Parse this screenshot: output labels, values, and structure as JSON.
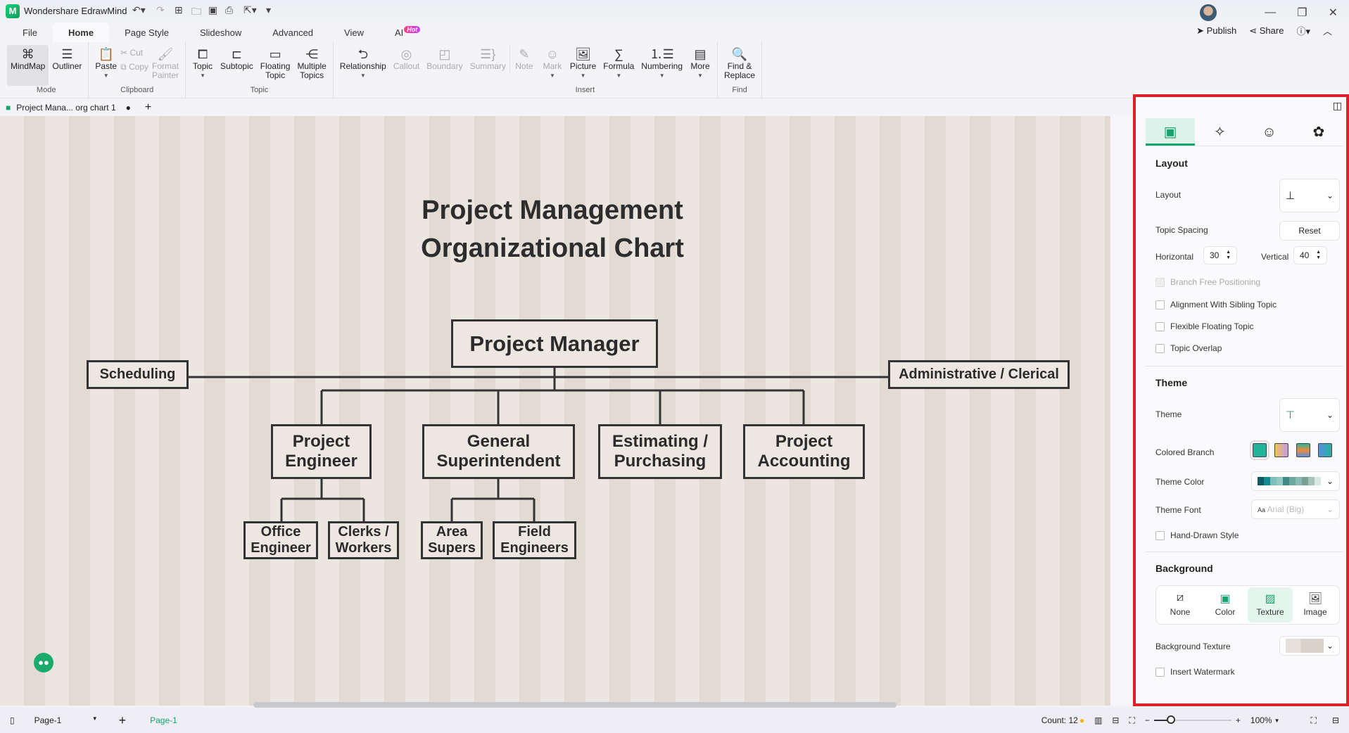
{
  "app": {
    "name": "Wondershare EdrawMind",
    "logo": "M"
  },
  "menu_tabs": [
    {
      "label": "File"
    },
    {
      "label": "Home",
      "active": true
    },
    {
      "label": "Page Style"
    },
    {
      "label": "Slideshow"
    },
    {
      "label": "Advanced"
    },
    {
      "label": "View"
    },
    {
      "label": "AI",
      "badge": "Hot"
    }
  ],
  "top_actions": {
    "publish": "Publish",
    "share": "Share"
  },
  "ribbon": {
    "mode": {
      "label": "Mode",
      "items": [
        "MindMap",
        "Outliner"
      ]
    },
    "clipboard": {
      "label": "Clipboard",
      "paste": "Paste",
      "cut": "Cut",
      "copy": "Copy",
      "format_painter": [
        "Format",
        "Painter"
      ]
    },
    "topic": {
      "label": "Topic",
      "items": [
        [
          "Topic",
          ""
        ],
        [
          "Subtopic",
          ""
        ],
        [
          "Floating",
          "Topic"
        ],
        [
          "Multiple",
          "Topics"
        ]
      ]
    },
    "insert": {
      "label": "Insert",
      "items": [
        "Relationship",
        "Callout",
        "Boundary",
        "Summary",
        "Note",
        "Mark",
        "Picture",
        "Formula",
        "Numbering",
        "More"
      ]
    },
    "find": {
      "label": "Find",
      "items": [
        "Find &",
        "Replace"
      ]
    }
  },
  "document_tab": {
    "title": "Project Mana... org chart 1"
  },
  "chart": {
    "title": [
      "Project Management",
      "Organizational Chart"
    ],
    "root": "Project Manager",
    "side": [
      "Scheduling",
      "Administrative / Clerical"
    ],
    "level2": [
      [
        "Project",
        "Engineer"
      ],
      [
        "General",
        "Superintendent"
      ],
      [
        "Estimating /",
        "Purchasing"
      ],
      [
        "Project",
        "Accounting"
      ]
    ],
    "level3": [
      [
        "Office",
        "Engineer"
      ],
      [
        "Clerks /",
        "Workers"
      ],
      [
        "Area",
        "Supers"
      ],
      [
        "Field",
        "Engineers"
      ]
    ]
  },
  "panel": {
    "tabs": [
      "layout-icon",
      "ai-style-icon",
      "mark-icon",
      "settings-icon"
    ],
    "layout_section": "Layout",
    "layout_label": "Layout",
    "topic_spacing": "Topic Spacing",
    "reset": "Reset",
    "horizontal_label": "Horizontal",
    "horizontal": "30",
    "vertical_label": "Vertical",
    "vertical": "40",
    "checks": [
      "Branch Free Positioning",
      "Alignment With Sibling Topic",
      "Flexible Floating Topic",
      "Topic Overlap"
    ],
    "theme_section": "Theme",
    "theme_label": "Theme",
    "colored_branch": "Colored Branch",
    "theme_color": "Theme Color",
    "theme_font": "Theme Font",
    "theme_font_value": "Arial (Big)",
    "hand_drawn": "Hand-Drawn Style",
    "background_section": "Background",
    "bg_options": [
      "None",
      "Color",
      "Texture",
      "Image"
    ],
    "bg_selected": "Texture",
    "bg_texture": "Background Texture",
    "watermark": "Insert Watermark",
    "theme_colors": [
      "#0d5c63",
      "#148a8f",
      "#7cbfbd",
      "#97c9c5",
      "#3f8a84",
      "#6aa8a1",
      "#8bbab2",
      "#7c9f95",
      "#a9c3bb",
      "#dbe7e3"
    ],
    "accent": "#16a36d"
  },
  "status": {
    "page_select": "Page-1",
    "page_tab": "Page-1",
    "count": "Count: 12",
    "zoom": "100%"
  }
}
